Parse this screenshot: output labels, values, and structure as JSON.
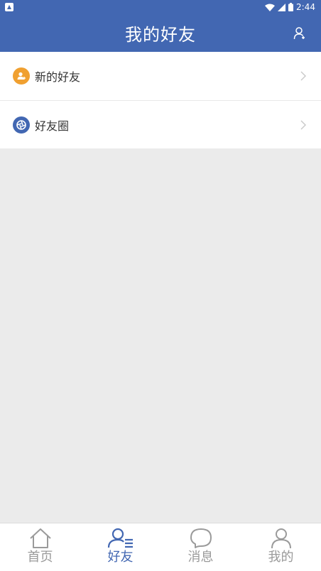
{
  "status_bar": {
    "time": "2:44"
  },
  "app_bar": {
    "title": "我的好友"
  },
  "list": [
    {
      "label": "新的好友",
      "icon": "new-friend-icon",
      "icon_color": "#f0a030"
    },
    {
      "label": "好友圈",
      "icon": "moments-icon",
      "icon_color": "#4267b2"
    }
  ],
  "tabs": [
    {
      "label": "首页",
      "icon": "home-icon",
      "active": false
    },
    {
      "label": "好友",
      "icon": "friends-icon",
      "active": true
    },
    {
      "label": "消息",
      "icon": "message-icon",
      "active": false
    },
    {
      "label": "我的",
      "icon": "profile-icon",
      "active": false
    }
  ],
  "colors": {
    "primary": "#4267b2",
    "inactive_tab": "#9a9a9a",
    "background": "#ebebeb"
  }
}
